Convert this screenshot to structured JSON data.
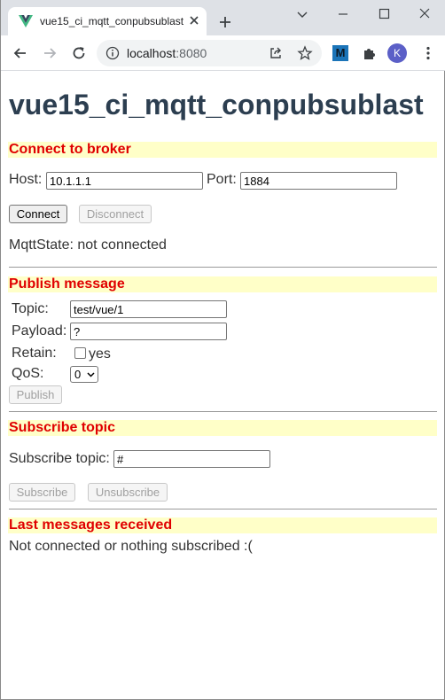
{
  "browser": {
    "tab_title": "vue15_ci_mqtt_conpubsublast",
    "url_host": "localhost",
    "url_port": ":8080",
    "profile_initial": "K",
    "extension_label": "M"
  },
  "page": {
    "heading": "vue15_ci_mqtt_conpubsublast",
    "connect": {
      "title": "Connect to broker",
      "host_label": "Host:",
      "host_value": "10.1.1.1",
      "port_label": "Port:",
      "port_value": "1884",
      "connect_button": "Connect",
      "disconnect_button": "Disconnect",
      "state_text": "MqttState: not connected"
    },
    "publish": {
      "title": "Publish message",
      "topic_label": "Topic:",
      "topic_value": "test/vue/1",
      "payload_label": "Payload:",
      "payload_value": "?",
      "retain_label": "Retain:",
      "retain_option": "yes",
      "qos_label": "QoS:",
      "qos_value": "0",
      "publish_button": "Publish"
    },
    "subscribe": {
      "title": "Subscribe topic",
      "topic_label": "Subscribe topic:",
      "topic_value": "#",
      "subscribe_button": "Subscribe",
      "unsubscribe_button": "Unsubscribe"
    },
    "messages": {
      "title": "Last messages received",
      "empty_text": "Not connected or nothing subscribed :("
    }
  },
  "colors": {
    "heading": "#2c3e50",
    "section_title": "#e00000",
    "section_background": "#ffffc8",
    "profile": "#5b5fc7"
  }
}
